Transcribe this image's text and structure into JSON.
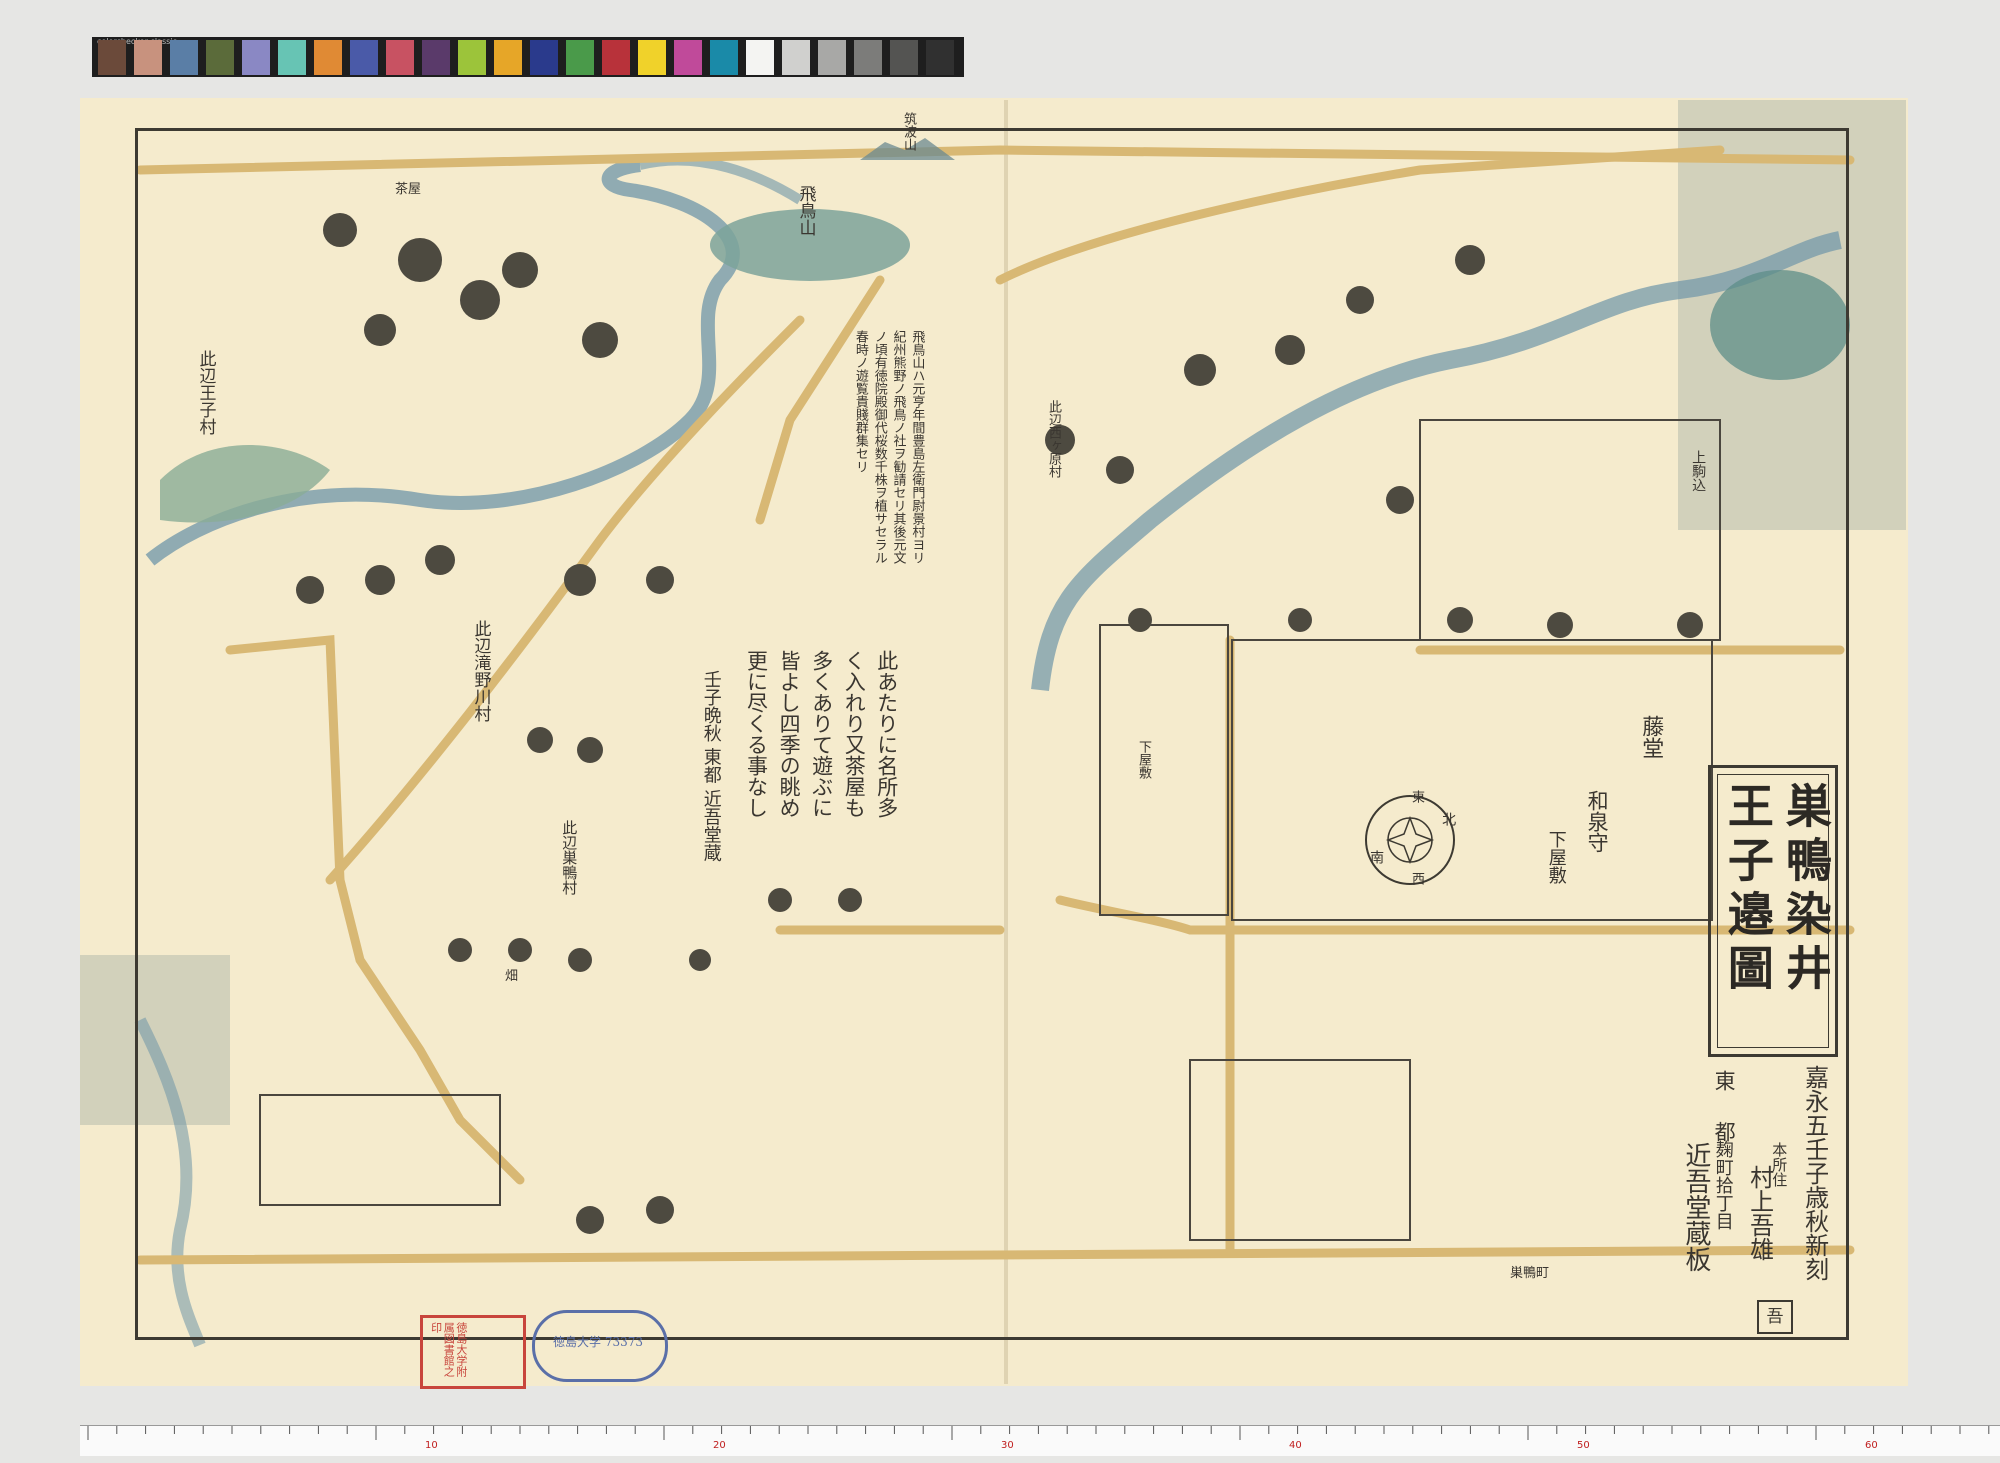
{
  "colorchecker": {
    "label": "colorchecker classic",
    "swatches": [
      "#6b4a3a",
      "#c8927e",
      "#5a7ea6",
      "#5b6b3a",
      "#8a88c4",
      "#67c4b4",
      "#e08a34",
      "#4a5aa8",
      "#c85262",
      "#5a3a6a",
      "#9cc43a",
      "#e6a628",
      "#2a3a8c",
      "#4a9a4a",
      "#b8323a",
      "#f0d22a",
      "#c04a9a",
      "#1a8aa8",
      "#f4f4f2",
      "#d0d0ce",
      "#a8a8a6",
      "#7c7c7a",
      "#545452",
      "#303030"
    ]
  },
  "map": {
    "title_line1": "巣鴨染井",
    "title_line2": "王子邉圖",
    "publisher_info": {
      "date": "嘉永五壬子歳秋新刻",
      "honsho": "本所住",
      "artist": "村上吾雄",
      "capital_label": "東都",
      "address": "麹町拾丁目",
      "publisher": "近吾堂蔵板",
      "seal_glyph": "吾"
    },
    "place_labels": {
      "asukayama": "飛鳥山",
      "tsukubasan": "筑波山",
      "oji_village": "此辺王子村",
      "takinogawa": "此辺滝野川村",
      "sugamo_village": "此辺巣鴨村",
      "nishigahara": "此辺西ヶ原村",
      "todo_estate_1": "藤堂",
      "todo_estate_2": "和泉守",
      "todo_estate_3": "下屋敷",
      "hatake": "畑",
      "komagome": "上駒込",
      "shimo_yashiki": "下屋敷",
      "sugamo_street": "巣鴨町",
      "chaya": "茶屋"
    },
    "compass": {
      "north": "北",
      "south": "南",
      "east": "東",
      "west": "西"
    },
    "notes": {
      "asukayama_note": "飛鳥山ハ元亨年間豊島左衛門尉景村ヨリ紀州熊野ノ飛鳥ノ社ヲ勧請セリ其後元文ノ頃有徳院殿御代桜数千株ヲ植サセラル春時ノ遊覧貴賤群集セリ",
      "poem": "此あたりに名所多く入れり又茶屋も多くありて遊ぶに皆よし四季の眺め更に尽くる事なし",
      "poem_signature": "壬子晩秋 東都 近吾堂蔵"
    },
    "stamps": {
      "red_stamp": "徳島大学附属図書館之印",
      "blue_stamp": "徳島大学 73373"
    }
  },
  "ruler": {
    "major_labels": [
      "10",
      "20",
      "30",
      "40",
      "50",
      "60"
    ]
  }
}
